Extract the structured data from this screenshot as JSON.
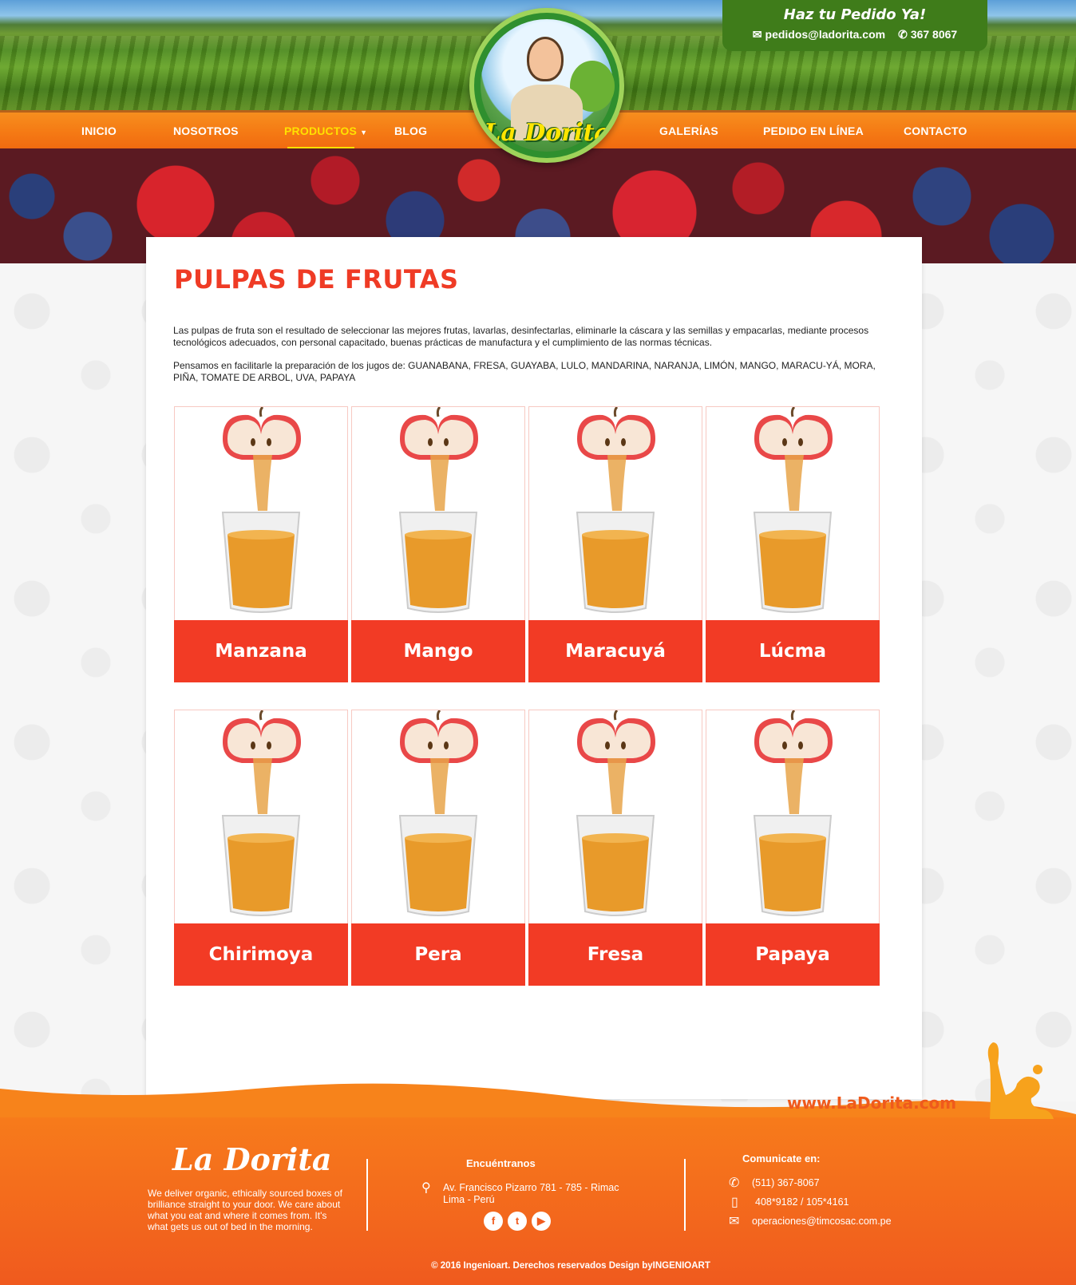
{
  "header": {
    "order": {
      "title": "Haz tu Pedido Ya!",
      "email": "pedidos@ladorita.com",
      "phone": "367 8067"
    },
    "logo_text": "La Dorita"
  },
  "nav": {
    "items": [
      {
        "label": "INICIO"
      },
      {
        "label": "NOSOTROS"
      },
      {
        "label": "PRODUCTOS",
        "active": true,
        "caret": "▼"
      },
      {
        "label": "BLOG"
      },
      {
        "label": "GALERÍAS"
      },
      {
        "label": "PEDIDO EN LÍNEA"
      },
      {
        "label": "CONTACTO"
      }
    ]
  },
  "content": {
    "title": "PULPAS DE FRUTAS",
    "intro_1": "Las pulpas de fruta son el resultado de seleccionar las mejores frutas, lavarlas, desinfectarlas, eliminarle la cáscara y las semillas y empacarlas, mediante procesos tecnológicos adecuados, con personal capacitado, buenas prácticas de manufactura y el cumplimiento de las normas técnicas.",
    "intro_2": "Pensamos en facilitarle la preparación de los jugos de:  GUANABANA, FRESA, GUAYABA, LULO, MANDARINA, NARANJA, LIMÓN, MANGO, MARACU-YÁ, MORA, PIÑA, TOMATE DE ARBOL, UVA, PAPAYA",
    "products": [
      {
        "name": "Manzana"
      },
      {
        "name": "Mango"
      },
      {
        "name": "Maracuyá"
      },
      {
        "name": "Lúcma"
      },
      {
        "name": "Chirimoya"
      },
      {
        "name": "Pera"
      },
      {
        "name": "Fresa"
      },
      {
        "name": "Papaya"
      }
    ]
  },
  "footer": {
    "url": "www.LaDorita.com",
    "brand": "La Dorita",
    "about": "We deliver organic, ethically sourced boxes of brilliance straight to your door. We care about what you eat and where it comes from. It's what gets us out of bed in the morning.",
    "find_title": "Encuéntranos",
    "address_1": "Av. Francisco Pizarro 781 - 785 - Rimac",
    "address_2": "Lima - Perú",
    "social": {
      "facebook": "f",
      "twitter": "t",
      "youtube": "▶"
    },
    "contact_title": "Comunicate en:",
    "phone": "(511) 367-8067",
    "mobile": "408*9182 / 105*4161",
    "email": "operaciones@timcosac.com.pe",
    "copyright": "© 2016 Ingenioart. Derechos reservados Design byINGENIOART"
  },
  "colors": {
    "accent_red": "#f23b25",
    "nav_orange": "#f57a14",
    "active_yellow": "#ffe100",
    "order_green": "#3f7c1a"
  }
}
